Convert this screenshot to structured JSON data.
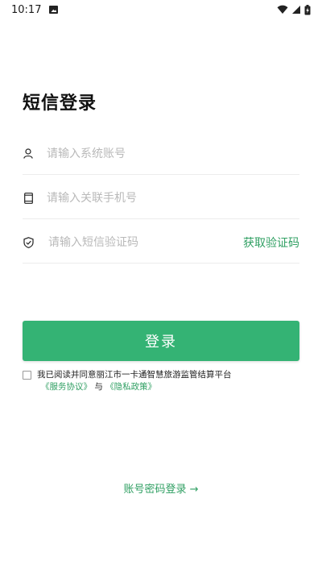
{
  "status_bar": {
    "time": "10:17",
    "icons": [
      "image-icon",
      "wifi-icon",
      "signal-icon",
      "battery-charging-icon"
    ]
  },
  "page": {
    "title": "短信登录"
  },
  "form": {
    "account_placeholder": "请输入系统账号",
    "phone_placeholder": "请输入关联手机号",
    "code_placeholder": "请输入短信验证码",
    "get_code_label": "获取验证码"
  },
  "login_button": {
    "label": "登录"
  },
  "agreement": {
    "checked": false,
    "text": "我已阅读并同意丽江市一卡通智慧旅游监管结算平台",
    "service_link": "《服务协议》",
    "connector": "与",
    "privacy_link": "《隐私政策》"
  },
  "alt_login": {
    "label": "账号密码登录 →"
  },
  "colors": {
    "accent": "#34b374",
    "link": "#2f9f62",
    "placeholder": "#b9b9b9"
  }
}
